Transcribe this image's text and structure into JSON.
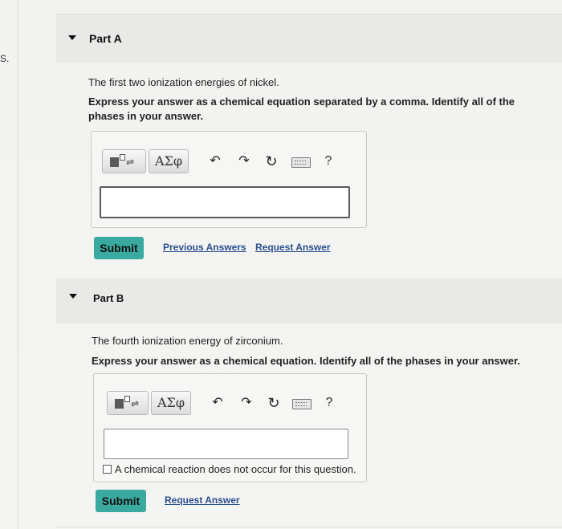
{
  "edge": {
    "mark": "S."
  },
  "partA": {
    "title": "Part A",
    "prompt": "The first two ionization energies of nickel.",
    "instruction_line1": "Express your answer as a chemical equation separated by a comma. Identify all of the",
    "instruction_line2": "phases in your answer.",
    "toolbar": {
      "greek": "ΑΣφ",
      "help": "?"
    },
    "submit": "Submit",
    "previous_answers": "Previous Answers",
    "request_answer": "Request Answer"
  },
  "partB": {
    "title": "Part B",
    "prompt": "The fourth ionization energy of zirconium.",
    "instruction": "Express your answer as a chemical equation. Identify all of the phases in your answer.",
    "toolbar": {
      "greek": "ΑΣφ",
      "help": "?"
    },
    "checkbox_label": "A chemical reaction does not occur for this question.",
    "submit": "Submit",
    "request_answer": "Request Answer"
  },
  "icons": {
    "template": "template-icon",
    "greek": "greek-symbols-icon",
    "undo": "undo-icon",
    "redo": "redo-icon",
    "reset": "reset-icon",
    "keyboard": "keyboard-icon",
    "help": "help-icon",
    "collapse": "caret-down-icon"
  },
  "colors": {
    "submit_bg": "#3aa99f",
    "link": "#2a4f8f"
  }
}
